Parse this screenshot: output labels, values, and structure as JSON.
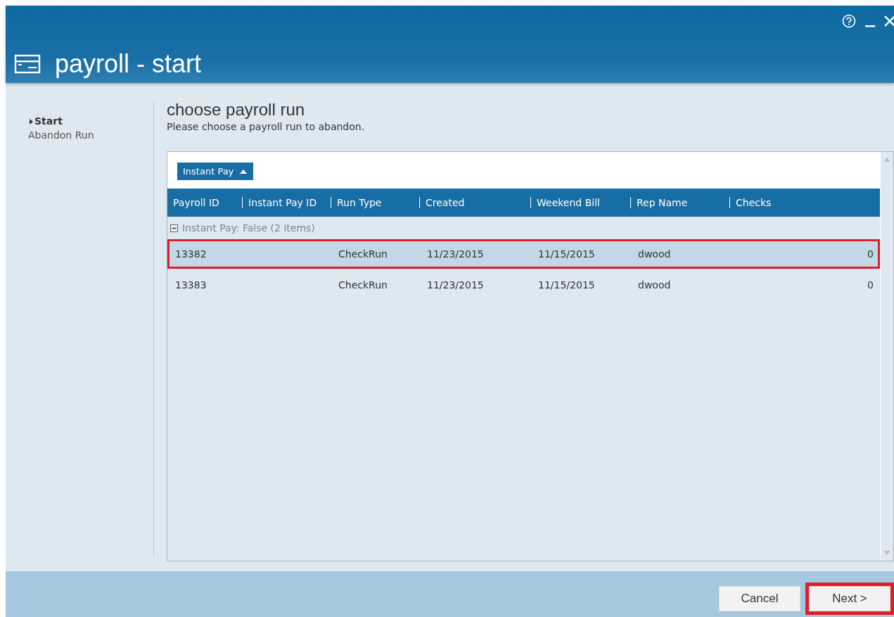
{
  "window": {
    "title": "payroll - start"
  },
  "sidebar": {
    "items": [
      {
        "label": "Start",
        "selected": true
      },
      {
        "label": "Abandon Run",
        "selected": false
      }
    ]
  },
  "page": {
    "heading": "choose payroll run",
    "instruction": "Please choose a payroll run to abandon."
  },
  "grid": {
    "group_by": "Instant Pay",
    "columns": [
      "Payroll ID",
      "Instant Pay ID",
      "Run Type",
      "Created",
      "Weekend Bill",
      "Rep Name",
      "Checks"
    ],
    "group": {
      "label": "Instant Pay: False (2 items)",
      "expanded": true
    },
    "rows": [
      {
        "cells": [
          "13382",
          "",
          "CheckRun",
          "11/23/2015",
          "11/15/2015",
          "dwood",
          "0"
        ],
        "selected": true,
        "highlighted": true
      },
      {
        "cells": [
          "13383",
          "",
          "CheckRun",
          "11/23/2015",
          "11/15/2015",
          "dwood",
          "0"
        ],
        "selected": false,
        "highlighted": false
      }
    ]
  },
  "buttons": [
    {
      "label": "Cancel",
      "highlighted": false
    },
    {
      "label": "Next >",
      "highlighted": true
    }
  ]
}
